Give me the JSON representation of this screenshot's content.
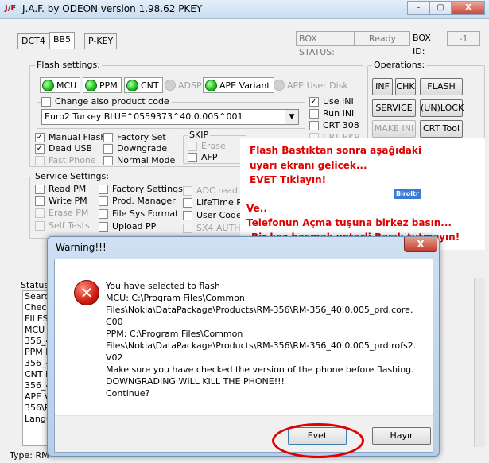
{
  "window": {
    "icon_text": "J/F",
    "title": "J.A.F. by ODEON version 1.98.62 PKEY",
    "caption_buttons": [
      "–",
      "▢",
      "X"
    ]
  },
  "tabs": [
    "DCT4",
    "BB5",
    "P-KEY"
  ],
  "box": {
    "status_label": "BOX STATUS:",
    "status_value": "Ready",
    "id_label": "BOX ID:",
    "id_value": "-1"
  },
  "flash_settings": {
    "label": "Flash settings:",
    "leds": [
      "MCU",
      "PPM",
      "CNT"
    ],
    "adsp": "ADSP",
    "ape_variant": "APE Variant",
    "ape_user_disk": "APE User Disk",
    "change_product_code": "Change also product code",
    "product_code": "Euro2 Turkey BLUE^0559373^40.0.005^001",
    "use_ini": "Use INI",
    "run_ini": "Run INI",
    "crt308": "CRT 308",
    "crt_bkp": "CRT BKP",
    "manual_flash": "Manual Flash",
    "dead_usb": "Dead USB",
    "fast_phone": "Fast Phone",
    "factory_set": "Factory Set",
    "downgrade": "Downgrade",
    "normal_mode": "Normal Mode",
    "skip_label": "SKIP",
    "erase": "Erase",
    "afp": "AFP"
  },
  "operations": {
    "label": "Operations:",
    "buttons": [
      "INF",
      "CHK",
      "FLASH",
      "SERVICE",
      "(UN)LOCK",
      "MAKE INI",
      "CRT Tool"
    ]
  },
  "service_settings": {
    "label": "Service Settings:",
    "col1": [
      "Read PM",
      "Write PM",
      "Erase PM",
      "Self Tests"
    ],
    "col2": [
      "Factory Settings",
      "Prod. Manager",
      "File Sys Format",
      "Upload PP"
    ],
    "col3": [
      "ADC reading",
      "LifeTime Res",
      "User Code E",
      "SX4 AUTH"
    ]
  },
  "status": {
    "label": "Status",
    "lines": [
      "Searc",
      "Check",
      "FILES",
      "MCU F",
      "356_4",
      "PPM F",
      "356_4",
      "CNT F",
      "356_4",
      "APE V",
      "356\\R",
      "Langu"
    ]
  },
  "statusbar": {
    "text": "Type: RM"
  },
  "annotation": {
    "line1": "Flash Bastıktan sonra aşağıdaki",
    "line2": "uyarı ekranı gelicek...",
    "line3": "EVET Tıklayın!",
    "badge": "Biroltr",
    "line4": "Ve..",
    "line5": "Telefonun Açma tuşuna birkez basın...",
    "line6": "Bir kez basmak yeterli Basılı tutmayın!"
  },
  "dialog": {
    "title": "Warning!!!",
    "close": "X",
    "icon": "error-icon",
    "lines": [
      "You have selected to flash",
      "MCU: C:\\Program Files\\Common",
      "Files\\Nokia\\DataPackage\\Products\\RM-356\\RM-356_40.0.005_prd.core.",
      "C00",
      "PPM: C:\\Program Files\\Common",
      "Files\\Nokia\\DataPackage\\Products\\RM-356\\RM-356_40.0.005_prd.rofs2.",
      "V02",
      "Make sure you have checked the version of the phone before flashing.",
      "DOWNGRADING WILL KILL THE PHONE!!!",
      "Continue?"
    ],
    "yes": "Evet",
    "no": "Hayır"
  },
  "colors": {
    "annotation_red": "#e00000",
    "led_green": "#19c019"
  }
}
